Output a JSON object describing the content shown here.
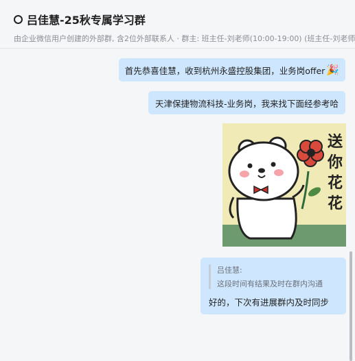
{
  "header": {
    "title": "吕佳慧-25秋专属学习群",
    "subtitle": "由企业微信用户创建的外部群, 含2位外部联系人 · 群主: 班主任-刘老师(10:00-19:00)  (班主任-刘老师(10:"
  },
  "messages": [
    {
      "text": "首先恭喜佳慧，收到杭州永盛控股集团，业务岗offer",
      "icon": "party-popper-icon"
    },
    {
      "text": "天津保捷物流科技-业务岗，我来找下面经参考哈"
    },
    {
      "sticker_text": "送你花花"
    },
    {
      "quote_author": "吕佳慧:",
      "quote_text": "这段时间有结果及时在群内沟通",
      "text": "好的，下次有进展群内及时同步"
    }
  ],
  "colors": {
    "bubble": "#cfe7fe",
    "background": "#f5f6f8",
    "sticker_bg": "#efeab6"
  }
}
